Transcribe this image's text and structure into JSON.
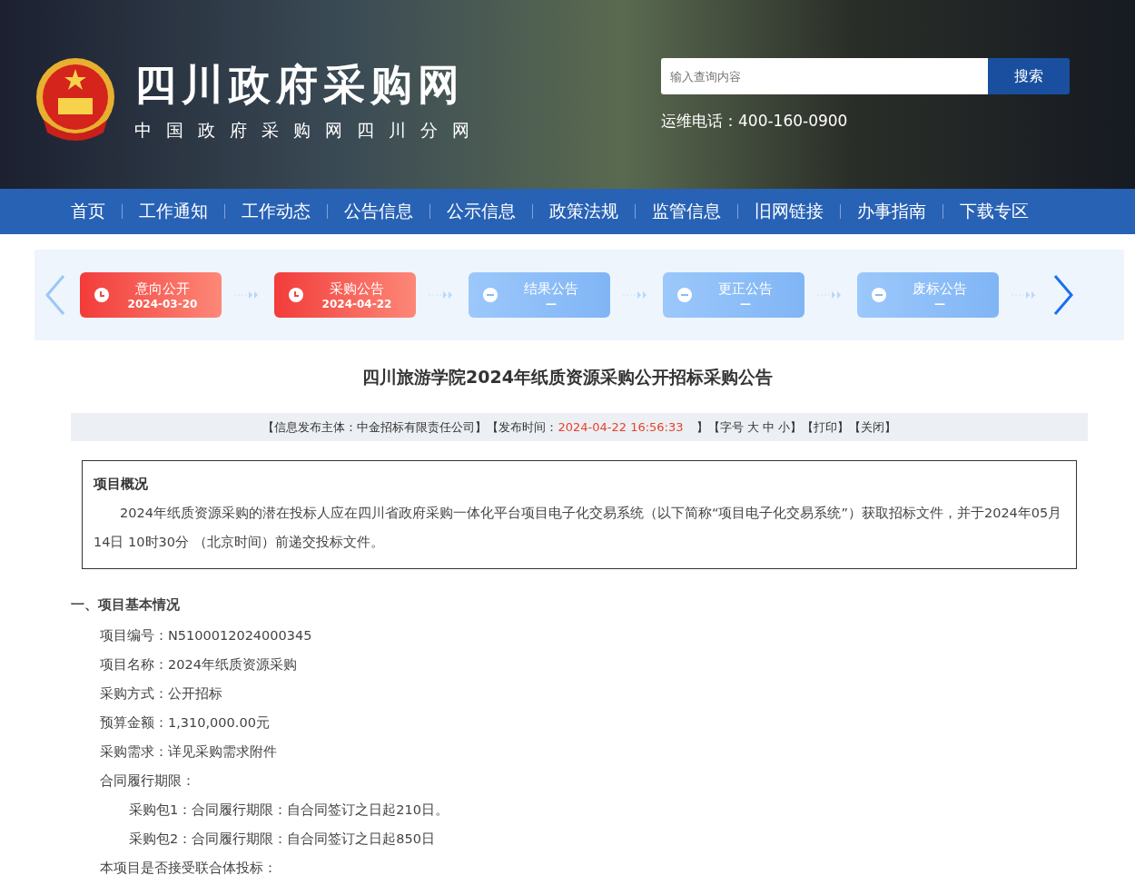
{
  "header": {
    "site_title": "四川政府采购网",
    "site_subtitle": "中国政府采购网四川分网",
    "search": {
      "placeholder": "输入查询内容",
      "button": "搜索"
    },
    "hotline": "运维电话：400-160-0900"
  },
  "nav": [
    "首页",
    "工作通知",
    "工作动态",
    "公告信息",
    "公示信息",
    "政策法规",
    "监管信息",
    "旧网链接",
    "办事指南",
    "下载专区"
  ],
  "steps": [
    {
      "label": "意向公开",
      "date": "2024-03-20",
      "done": true
    },
    {
      "label": "采购公告",
      "date": "2024-04-22",
      "done": true
    },
    {
      "label": "结果公告",
      "date": "—",
      "done": false
    },
    {
      "label": "更正公告",
      "date": "—",
      "done": false
    },
    {
      "label": "废标公告",
      "date": "—",
      "done": false
    }
  ],
  "article": {
    "title": "四川旅游学院2024年纸质资源采购公开招标采购公告",
    "meta": {
      "publisher": "【信息发布主体：中金招标有限责任公司】",
      "time_label": "【发布时间：",
      "time": "2024-04-22 16:56:33",
      "time_close": "】",
      "font_label": "【字号",
      "font_sizes": [
        "大",
        "中",
        "小"
      ],
      "font_close": "】",
      "print": "【打印】",
      "close": "【关闭】"
    },
    "overview": {
      "heading": "项目概况",
      "text": "2024年纸质资源采购的潜在投标人应在四川省政府采购一体化平台项目电子化交易系统（以下简称“项目电子化交易系统”）获取招标文件，并于2024年05月14日  10时30分  （北京时间）前递交投标文件。"
    },
    "section_heading": "一、项目基本情况",
    "lines": [
      {
        "text": "项目编号：N5100012024000345"
      },
      {
        "text": "项目名称：2024年纸质资源采购"
      },
      {
        "text": "采购方式：公开招标"
      },
      {
        "text": "预算金额：1,310,000.00元"
      },
      {
        "text": "采购需求：详见采购需求附件"
      },
      {
        "text": "合同履行期限：",
        "children": [
          {
            "text": "采购包1：合同履行期限：自合同签订之日起210日。"
          },
          {
            "text": "采购包2：合同履行期限：自合同签订之日起850日"
          }
        ]
      },
      {
        "text": "本项目是否接受联合体投标："
      }
    ]
  }
}
